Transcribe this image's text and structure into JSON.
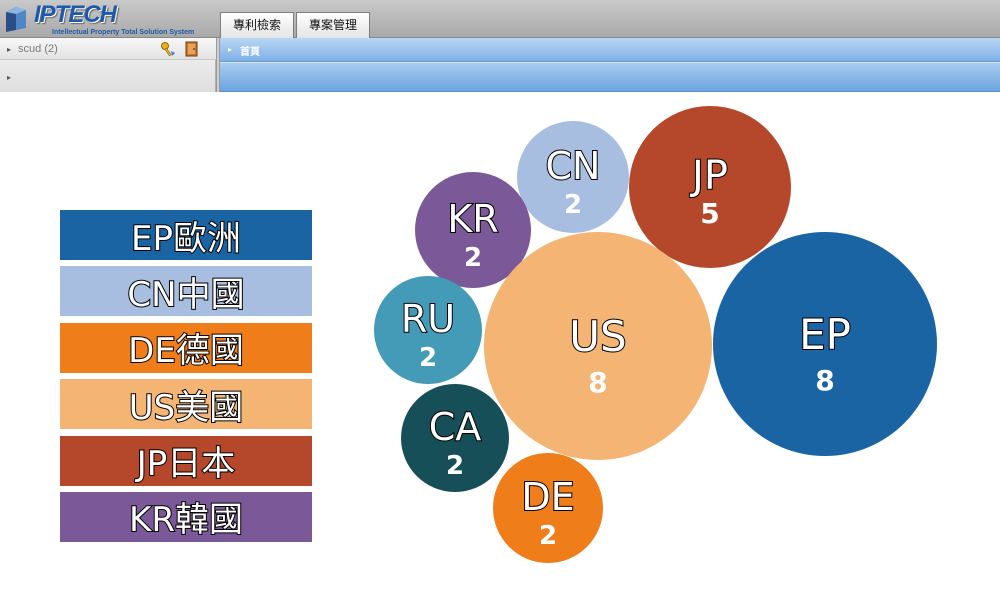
{
  "app": {
    "logo_text": "IPTECH",
    "logo_tagline": "Intellectual Property Total Solution System"
  },
  "tabs": [
    {
      "label": "專利檢索"
    },
    {
      "label": "專案管理"
    }
  ],
  "left_panel": {
    "user": "scud",
    "count": "(2)"
  },
  "right_panel": {
    "home_label": "首頁"
  },
  "legend": [
    {
      "label": "EP歐洲",
      "color": "#1a64a3"
    },
    {
      "label": "CN中國",
      "color": "#a8bee0"
    },
    {
      "label": "DE德國",
      "color": "#ee7d1a"
    },
    {
      "label": "US美國",
      "color": "#f4b473"
    },
    {
      "label": "JP日本",
      "color": "#b5472a"
    },
    {
      "label": "KR韓國",
      "color": "#7b5897"
    }
  ],
  "chart_data": {
    "type": "bubble",
    "series": [
      {
        "code": "CN",
        "value": 2,
        "color": "#a8bee0"
      },
      {
        "code": "JP",
        "value": 5,
        "color": "#b5472a"
      },
      {
        "code": "KR",
        "value": 2,
        "color": "#7b5897"
      },
      {
        "code": "RU",
        "value": 2,
        "color": "#449bb8"
      },
      {
        "code": "US",
        "value": 8,
        "color": "#f4b473"
      },
      {
        "code": "EP",
        "value": 8,
        "color": "#1a64a3"
      },
      {
        "code": "CA",
        "value": 2,
        "color": "#174f58"
      },
      {
        "code": "DE",
        "value": 2,
        "color": "#ee7d1a"
      }
    ]
  }
}
